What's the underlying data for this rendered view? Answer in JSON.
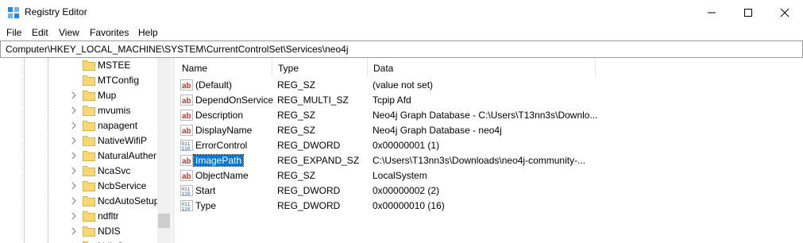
{
  "window": {
    "title": "Registry Editor"
  },
  "menu": [
    "File",
    "Edit",
    "View",
    "Favorites",
    "Help"
  ],
  "address": {
    "path": "Computer\\HKEY_LOCAL_MACHINE\\SYSTEM\\CurrentControlSet\\Services\\neo4j"
  },
  "tree": {
    "items": [
      {
        "label": "MSTEE",
        "has_children": false
      },
      {
        "label": "MTConfig",
        "has_children": false
      },
      {
        "label": "Mup",
        "has_children": true
      },
      {
        "label": "mvumis",
        "has_children": true
      },
      {
        "label": "napagent",
        "has_children": true
      },
      {
        "label": "NativeWifiP",
        "has_children": true
      },
      {
        "label": "NaturalAuther",
        "has_children": true
      },
      {
        "label": "NcaSvc",
        "has_children": true
      },
      {
        "label": "NcbService",
        "has_children": true
      },
      {
        "label": "NcdAutoSetup",
        "has_children": true
      },
      {
        "label": "ndfltr",
        "has_children": true
      },
      {
        "label": "NDIS",
        "has_children": true
      },
      {
        "label": "NdisCap",
        "has_children": true
      }
    ]
  },
  "list": {
    "columns": {
      "name": "Name",
      "type": "Type",
      "data": "Data"
    },
    "rows": [
      {
        "name": "(Default)",
        "type": "REG_SZ",
        "data": "(value not set)",
        "icon": "string-value-icon"
      },
      {
        "name": "DependOnService",
        "type": "REG_MULTI_SZ",
        "data": "Tcpip Afd",
        "icon": "string-value-icon"
      },
      {
        "name": "Description",
        "type": "REG_SZ",
        "data": "Neo4j Graph Database - C:\\Users\\T13nn3s\\Downlo...",
        "icon": "string-value-icon"
      },
      {
        "name": "DisplayName",
        "type": "REG_SZ",
        "data": "Neo4j Graph Database - neo4j",
        "icon": "string-value-icon"
      },
      {
        "name": "ErrorControl",
        "type": "REG_DWORD",
        "data": "0x00000001 (1)",
        "icon": "binary-value-icon"
      },
      {
        "name": "ImagePath",
        "type": "REG_EXPAND_SZ",
        "data": "C:\\Users\\T13nn3s\\Downloads\\neo4j-community-...",
        "icon": "string-value-icon",
        "selected": true
      },
      {
        "name": "ObjectName",
        "type": "REG_SZ",
        "data": "LocalSystem",
        "icon": "string-value-icon"
      },
      {
        "name": "Start",
        "type": "REG_DWORD",
        "data": "0x00000002 (2)",
        "icon": "binary-value-icon"
      },
      {
        "name": "Type",
        "type": "REG_DWORD",
        "data": "0x00000010 (16)",
        "icon": "binary-value-icon"
      }
    ]
  },
  "colors": {
    "selection": "#0078d7",
    "folder": "#f8d775",
    "string_icon": "#c0392b",
    "binary_icon": "#2e5aa8"
  }
}
